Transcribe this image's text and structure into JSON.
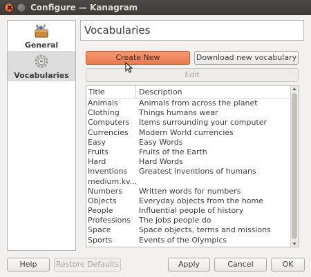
{
  "window": {
    "title": "Configure — Kanagram"
  },
  "sidebar": {
    "items": [
      {
        "label": "General",
        "icon": "toolbox-icon"
      },
      {
        "label": "Vocabularies",
        "icon": "gears-icon"
      }
    ]
  },
  "page": {
    "heading": "Vocabularies"
  },
  "buttons": {
    "create_new": "Create New",
    "download": "Download new vocabulary",
    "edit": "Edit",
    "help": "Help",
    "restore_defaults": "Restore Defaults",
    "apply": "Apply",
    "cancel": "Cancel",
    "ok": "OK"
  },
  "list": {
    "headers": [
      "Title",
      "Description"
    ],
    "rows": [
      [
        "Animals",
        "Animals from across the planet"
      ],
      [
        "Clothing",
        "Things humans wear"
      ],
      [
        "Computers",
        "Items surrounding your computer"
      ],
      [
        "Currencies",
        "Modern World currencies"
      ],
      [
        "Easy",
        "Easy Words"
      ],
      [
        "Fruits",
        "Fruits of the Earth"
      ],
      [
        "Hard",
        "Hard Words"
      ],
      [
        "Inventions",
        "Greatest inventions of humans"
      ],
      [
        "medium.kv...",
        ""
      ],
      [
        "Numbers",
        "Written words for numbers"
      ],
      [
        "Objects",
        "Everyday objects from the home"
      ],
      [
        "People",
        "Influential people of history"
      ],
      [
        "Professions",
        "The jobs people do"
      ],
      [
        "Space",
        "Space objects, terms and missions"
      ],
      [
        "Sports",
        "Events of the Olympics"
      ]
    ]
  },
  "colors": {
    "accent": "#ea7a50",
    "titlebar": "#3c3b37",
    "close": "#df4a16"
  }
}
